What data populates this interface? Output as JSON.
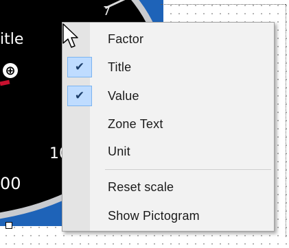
{
  "gauge": {
    "title": "itle",
    "tick_top": "7",
    "tick_mid": "10",
    "tick_low": "00",
    "pictogram_icon": "crosshair-icon",
    "colors": {
      "frame": "#1e63b8",
      "face": "#000000",
      "ring": "#c9cbcf",
      "needle": "#c8102e"
    }
  },
  "context_menu": {
    "items": [
      {
        "label": "Factor",
        "checked": false
      },
      {
        "label": "Title",
        "checked": true
      },
      {
        "label": "Value",
        "checked": true
      },
      {
        "label": "Zone Text",
        "checked": false
      },
      {
        "label": "Unit",
        "checked": false
      },
      {
        "label": "Reset scale",
        "checked": false
      },
      {
        "label": "Show Pictogram",
        "checked": false
      }
    ],
    "check_glyph": "✔",
    "colors": {
      "background": "#f2f2f2",
      "check_highlight": "#bfdcff"
    }
  },
  "cursor_icon": "arrow-pointer-icon"
}
